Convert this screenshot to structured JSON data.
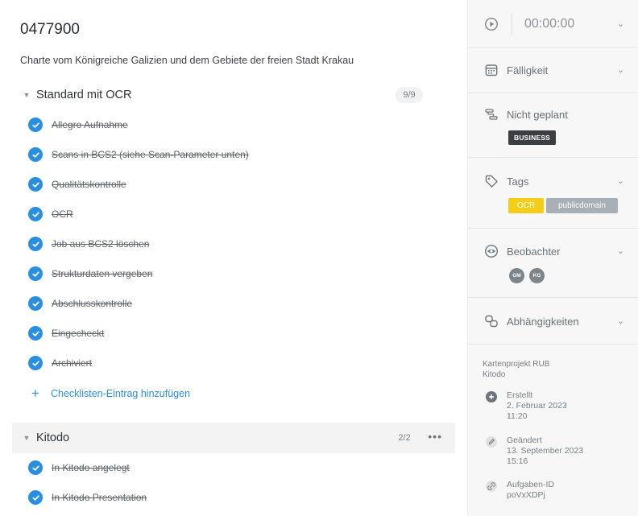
{
  "task": {
    "title": "0477900",
    "description": "Charte vom Königreiche Galizien und dem Gebiete der freien Stadt Krakau"
  },
  "checklists": [
    {
      "title": "Standard mit OCR",
      "count": "9/9",
      "items": [
        "Allegro Aufnahme",
        "Scans in BCS2 (siehe Scan-Parameter unten)",
        "Qualitätskontrolle",
        "OCR",
        "Job aus BCS2 löschen",
        "Strukturdaten vergeben",
        "Abschlusskontrolle",
        "Eingecheckt",
        "Archiviert"
      ],
      "add_label": "Checklisten-Eintrag hinzufügen"
    },
    {
      "title": "Kitodo",
      "count": "2/2",
      "more": "•••",
      "items": [
        "In Kitodo angelegt",
        "In Kitodo Presentation"
      ]
    }
  ],
  "sidebar": {
    "timer": "00:00:00",
    "due": "Fälligkeit",
    "plan": {
      "label": "Nicht geplant",
      "badge": "BUSINESS"
    },
    "tags": {
      "label": "Tags",
      "items": [
        "OCR",
        "publicdomain"
      ]
    },
    "watchers": {
      "label": "Beobachter",
      "avatars": [
        "GM",
        "KG"
      ]
    },
    "dependencies": "Abhängigkeiten",
    "project": [
      "Kartenprojekt RUB",
      "Kitodo"
    ],
    "created": {
      "label": "Erstellt",
      "date": "2. Februar 2023",
      "time": "11:20"
    },
    "changed": {
      "label": "Geändert",
      "date": "13. September 2023",
      "time": "15:16"
    },
    "task_id": {
      "label": "Aufgaben-ID",
      "value": "poVxXDPj"
    }
  },
  "colors": {
    "accent": "#2b8fe0",
    "tag_ocr": "#f5cd16",
    "tag_pd": "#a7b0b6",
    "badge": "#3b3f42"
  }
}
